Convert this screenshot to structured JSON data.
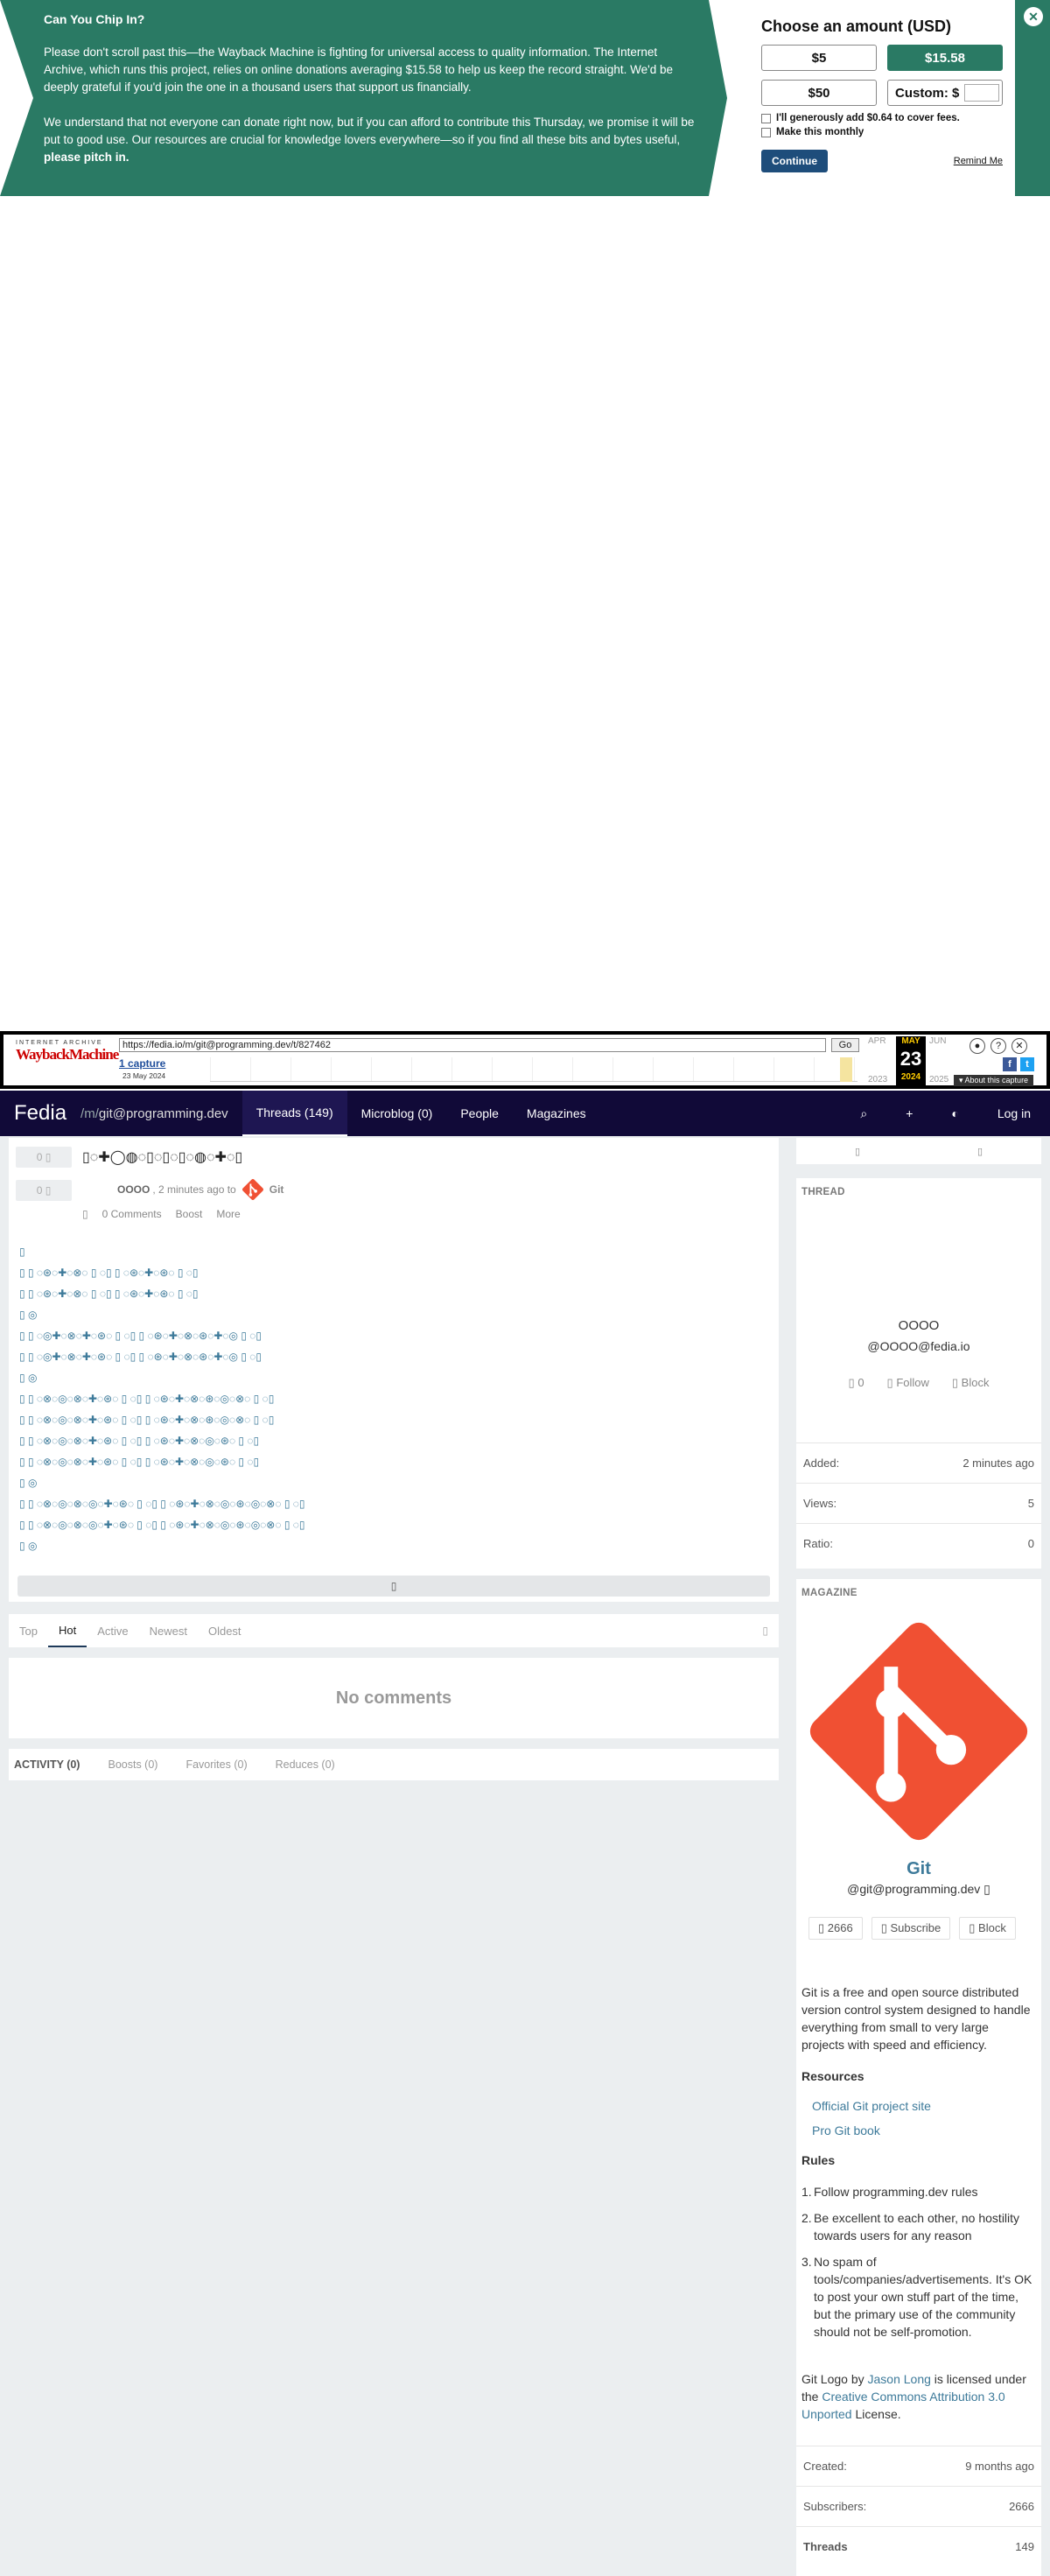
{
  "donation": {
    "title": "Can You Chip In?",
    "para1": "Please don't scroll past this—the Wayback Machine is fighting for universal access to quality information. The Internet Archive, which runs this project, relies on online donations averaging $15.58 to help us keep the record straight. We'd be deeply grateful if you'd join the one in a thousand users that support us financially.",
    "para2_start": "We understand that not everyone can donate right now, but if you can afford to contribute this Thursday, we promise it will be put to good use. Our resources are crucial for knowledge lovers everywhere—so if you find all these bits and bytes useful, ",
    "para2_bold": "please pitch in.",
    "panel_title": "Choose an amount (USD)",
    "amounts": [
      "$5",
      "$15.58",
      "$50",
      "Custom: $"
    ],
    "cover_fees_label": "I'll generously add $0.64 to cover fees.",
    "monthly_label": "Make this monthly",
    "continue_label": "Continue",
    "remind_label": "Remind Me",
    "close_glyph": "✕"
  },
  "wayback": {
    "logo_top": "INTERNET ARCHIVE",
    "logo_main": "WaybackMachine",
    "url": "https://fedia.io/m/git@programming.dev/t/827462",
    "go_label": "Go",
    "captures_label": "1 capture",
    "capture_date": "23 May 2024",
    "months": [
      "APR",
      "MAY",
      "JUN"
    ],
    "day": "23",
    "years": [
      "2023",
      "2024",
      "2025"
    ],
    "about_label": "▾ About this capture"
  },
  "header": {
    "logo": "Fedia",
    "magazine_prefix": "/m/",
    "magazine": "git@programming.dev",
    "nav": [
      "Threads (149)",
      "Microblog (0)",
      "People",
      "Magazines"
    ],
    "right_icons": [
      "⌕",
      "+",
      "◐"
    ],
    "login_label": "Log in"
  },
  "post": {
    "vote_up": "0 ▯",
    "vote_down": "0 ▯",
    "title": "▯◌✚◯◍◌▯◌▯◌▯◌◍◌✚◌▯",
    "author": "OOOO",
    "time": ", 2 minutes ago to",
    "magazine_label": "Git",
    "comments_label": "0 Comments",
    "boost_label": "Boost",
    "more_label": "More",
    "body_lines": [
      "▯",
      "▯ ▯ ◌⊛◌✚◌⊗◌ ▯ ◌▯ ▯ ◌⊛◌✚◌⊛◌ ▯ ◌▯",
      "▯ ▯ ◌⊛◌✚◌⊗◌ ▯ ◌▯ ▯ ◌⊛◌✚◌⊛◌ ▯ ◌▯",
      " ▯ ◎",
      "▯ ▯ ◌◎✚◌⊗◌✚◌⊛◌ ▯ ◌▯ ▯ ◌⊛◌✚◌⊗◌⊛◌✚◌◎ ▯ ◌▯",
      "▯ ▯ ◌◎✚◌⊗◌✚◌⊛◌ ▯ ◌▯ ▯ ◌⊛◌✚◌⊗◌⊛◌✚◌◎ ▯ ◌▯",
      " ▯ ◎",
      "▯ ▯ ◌⊗◌◎◌⊗◌✚◌⊛◌ ▯ ◌▯ ▯ ◌⊛◌✚◌⊗◌⊛◌◎◌⊗◌ ▯ ◌▯",
      "▯ ▯ ◌⊗◌◎◌⊗◌✚◌⊛◌ ▯ ◌▯ ▯ ◌⊛◌✚◌⊗◌⊛◌◎◌⊗◌ ▯ ◌▯",
      "▯ ▯ ◌⊗◌◎◌⊗◌✚◌⊛◌ ▯ ◌▯ ▯ ◌⊛◌✚◌⊗◌◎◌⊛◌ ▯ ◌▯",
      "▯ ▯ ◌⊗◌◎◌⊗◌✚◌⊛◌ ▯ ◌▯ ▯ ◌⊛◌✚◌⊗◌◎◌⊛◌ ▯ ◌▯",
      " ▯ ◎",
      "▯ ▯ ◌⊗◌◎◌⊗◌◎◌✚◌⊛◌ ▯ ◌▯ ▯ ◌⊛◌✚◌⊗◌◎◌⊛◌◎◌⊗◌ ▯ ◌▯",
      "▯ ▯ ◌⊗◌◎◌⊗◌◎◌✚◌⊛◌ ▯ ◌▯ ▯ ◌⊛◌✚◌⊗◌◎◌⊛◌◎◌⊗◌ ▯ ◌▯",
      " ▯ ◎"
    ],
    "collapse_glyph": "▯"
  },
  "sort": {
    "options": [
      "Top",
      "Hot",
      "Active",
      "Newest",
      "Oldest"
    ],
    "caret": "▯"
  },
  "comments": {
    "empty_label": "No comments"
  },
  "activity": {
    "items": [
      "ACTIVITY (0)",
      "Boosts (0)",
      "Favorites (0)",
      "Reduces (0)"
    ]
  },
  "sidebar": {
    "top_icons": [
      "▯",
      "▯"
    ],
    "thread": {
      "heading": "THREAD",
      "author_name": "OOOO",
      "author_handle": "@OOOO@fedia.io",
      "actions": [
        "▯ 0",
        "▯ Follow",
        "▯ Block"
      ],
      "stats": [
        {
          "label": "Added:",
          "value": "2 minutes ago"
        },
        {
          "label": "Views:",
          "value": "5"
        },
        {
          "label": "Ratio:",
          "value": "0"
        }
      ]
    },
    "magazine": {
      "heading": "MAGAZINE",
      "name": "Git",
      "handle": "@git@programming.dev ▯",
      "actions": [
        "▯ 2666",
        "▯ Subscribe",
        "▯ Block"
      ],
      "description": "Git is a free and open source distributed version control system designed to handle everything from small to very large projects with speed and efficiency.",
      "resources_heading": "Resources",
      "resources": [
        "Official Git project site",
        "Pro Git book"
      ],
      "rules_heading": "Rules",
      "rules": [
        "Follow programming.dev rules",
        "Be excellent to each other, no hostility towards users for any reason",
        "No spam of tools/companies/advertisements. It's OK to post your own stuff part of the time, but the primary use of the community should not be self-promotion."
      ],
      "credit_a": "Git Logo by ",
      "credit_author": "Jason Long",
      "credit_b": " is licensed under the ",
      "credit_license": "Creative Commons Attribution 3.0 Unported",
      "credit_c": " License.",
      "stats": [
        {
          "label": "Created:",
          "value": "9 months ago"
        },
        {
          "label": "Subscribers:",
          "value": "2666"
        },
        {
          "label": "Threads",
          "value": "149"
        }
      ]
    }
  },
  "colors": {
    "donate_green": "#2a7a64",
    "fedia_header": "#110a38",
    "git_orange": "#f05033",
    "link_blue": "#3d7a9a"
  }
}
